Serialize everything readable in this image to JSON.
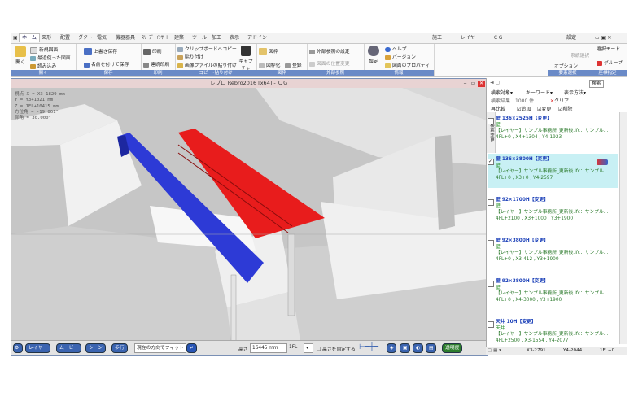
{
  "tabs": [
    "ホーム",
    "図形",
    "配置",
    "ダクト",
    "電気",
    "機器器具",
    "ｽﾘｰﾌﾞ･ｲﾝｻｰﾄ",
    "建築",
    "ツール",
    "加工",
    "表示",
    "アドイン"
  ],
  "right_tabs": [
    "施工",
    "レイヤー",
    "ＣＧ",
    "設定"
  ],
  "ribbon": {
    "file": {
      "open": "開く",
      "new": "新規図面",
      "recent": "最近使った図面",
      "read": "読み込み",
      "label": "開く"
    },
    "save": {
      "overwrite": "上書き保存",
      "saveas": "名前を付けて保存",
      "label": "保存"
    },
    "print": {
      "print": "印刷",
      "cont": "連続印刷",
      "label": "印刷"
    },
    "copy": {
      "clip": "クリップボードへコピー",
      "paste": "貼り付け",
      "imgpaste": "画像ファイルの貼り付け",
      "capture": "キャプチャ",
      "label": "コピー･貼り付け"
    },
    "frame": {
      "frame": "図枠",
      "frameize": "図枠化",
      "register": "登録",
      "label": "図枠"
    },
    "ext": {
      "setting": "外部参照の設定",
      "posmove": "図面の位置変更",
      "label": "外部参照"
    },
    "info": {
      "settings": "設定",
      "help": "ヘルプ",
      "version": "バージョン",
      "props": "図面のプロパティ",
      "label": "情報"
    },
    "sel": {
      "mode": "選択モード",
      "sysmode": "系統選択",
      "group": "グループ",
      "option": "オプション",
      "label1": "要素選択",
      "label2": "座標指定"
    }
  },
  "viewport": {
    "title": "レブロ Rebro2016 [x64] - ＣＧ",
    "coords": [
      "視点 X = X3-1829 mm",
      "    Y = Y3+1021 mm",
      "    Z = 1FL+10415 mm",
      "方位角 = -19.861°",
      "仰角 = 30.000°"
    ]
  },
  "bottom": {
    "layer": "レイヤー",
    "movie": "ムービー",
    "scene": "シーン",
    "walk": "歩行",
    "fit": "現在の方向でフィット",
    "height_label": "高さ",
    "height": "16445 mm",
    "floor": "1FL",
    "fix": "高さを固定する",
    "transp": "透明度"
  },
  "panel": {
    "search_target": "検索対象",
    "keyword": "キーワード",
    "display": "表示方法",
    "search_btn": "検索",
    "result": "検索結果　1000 件",
    "clear": "クリア",
    "compare": "再比較",
    "add": "追加",
    "change": "変更",
    "delete": "削除",
    "items": [
      {
        "title": "壁 136×2525H【変更】",
        "kind": "壁",
        "file": "【レイヤー】サンプル事務所_更新後.ifc：サンプル…",
        "pos": "4FL+0 , X4+1304 , Y4-1923",
        "checked": false,
        "selected": false
      },
      {
        "title": "壁 136×3800H【変更】",
        "kind": "壁",
        "file": "【レイヤー】サンプル事務所_更新後.ifc：サンプル…",
        "pos": "4FL+0 , X3+0 , Y4-2597",
        "checked": true,
        "selected": true
      },
      {
        "title": "壁 92×1700H【変更】",
        "kind": "壁",
        "file": "【レイヤー】サンプル事務所_更新後.ifc：サンプル…",
        "pos": "4FL+2100 , X3+1000 , Y3+1900",
        "checked": false,
        "selected": false
      },
      {
        "title": "壁 92×3800H【変更】",
        "kind": "壁",
        "file": "【レイヤー】サンプル事務所_更新後.ifc：サンプル…",
        "pos": "4FL+0 , X3-412 , Y3+1900",
        "checked": false,
        "selected": false
      },
      {
        "title": "壁 92×3800H【変更】",
        "kind": "壁",
        "file": "【レイヤー】サンプル事務所_更新後.ifc：サンプル…",
        "pos": "4FL+0 , X4-3000 , Y3+1900",
        "checked": false,
        "selected": false
      },
      {
        "title": "天井 10H【変更】",
        "kind": "天井",
        "file": "【レイヤー】サンプル事務所_更新後.ifc：サンプル…",
        "pos": "4FL+2500 , X3-1554 , Y4-2077",
        "checked": false,
        "selected": false
      }
    ],
    "side_labels": [
      "検索",
      "変更"
    ]
  },
  "status": {
    "x": "X3-2791",
    "y": "Y4-2044",
    "fl": "1FL+0"
  },
  "colors": {
    "blue_wall": "#2d3ad6",
    "red_wall": "#e81c1c",
    "ribbon_blue": "#6a8ac7"
  }
}
